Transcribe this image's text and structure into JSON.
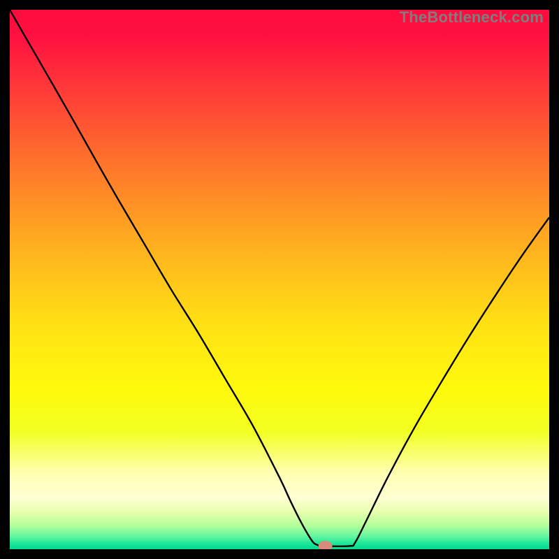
{
  "watermark": "TheBottleneck.com",
  "chart_data": {
    "type": "line",
    "title": "",
    "xlabel": "",
    "ylabel": "",
    "xlim": [
      0,
      100
    ],
    "ylim": [
      0,
      100
    ],
    "grid": false,
    "legend": false,
    "background_gradient": {
      "stops": [
        {
          "offset": 0.0,
          "color": "#ff0a3f"
        },
        {
          "offset": 0.05,
          "color": "#ff1140"
        },
        {
          "offset": 0.15,
          "color": "#ff3b38"
        },
        {
          "offset": 0.3,
          "color": "#ff7a2a"
        },
        {
          "offset": 0.45,
          "color": "#ffb41e"
        },
        {
          "offset": 0.58,
          "color": "#ffe014"
        },
        {
          "offset": 0.7,
          "color": "#fff90c"
        },
        {
          "offset": 0.78,
          "color": "#f2ff20"
        },
        {
          "offset": 0.86,
          "color": "#ffffb4"
        },
        {
          "offset": 0.905,
          "color": "#ffffd2"
        },
        {
          "offset": 0.93,
          "color": "#e9ffb0"
        },
        {
          "offset": 0.955,
          "color": "#b6ff9a"
        },
        {
          "offset": 0.975,
          "color": "#68f7a0"
        },
        {
          "offset": 0.99,
          "color": "#1ae699"
        },
        {
          "offset": 1.0,
          "color": "#00d990"
        }
      ]
    },
    "series": [
      {
        "name": "bottleneck-curve",
        "color": "#000000",
        "width": 2.4,
        "x": [
          0,
          2,
          5,
          8,
          12,
          16,
          20,
          25,
          30,
          35,
          40,
          45,
          50,
          52,
          54,
          56,
          57,
          58,
          63,
          64,
          66,
          70,
          75,
          80,
          85,
          90,
          95,
          100
        ],
        "y": [
          100,
          96.5,
          91.3,
          86.1,
          79.1,
          72,
          65,
          56.5,
          48,
          40,
          31.5,
          23,
          13.3,
          9,
          5,
          1.6,
          0.8,
          0.6,
          0.6,
          1.2,
          5.1,
          13.2,
          22.5,
          31,
          39.2,
          47,
          54.5,
          61.5
        ]
      }
    ],
    "marker": {
      "x": 58.5,
      "y": 0.6,
      "rx": 1.3,
      "ry": 0.95,
      "color": "#d98b7a"
    }
  }
}
